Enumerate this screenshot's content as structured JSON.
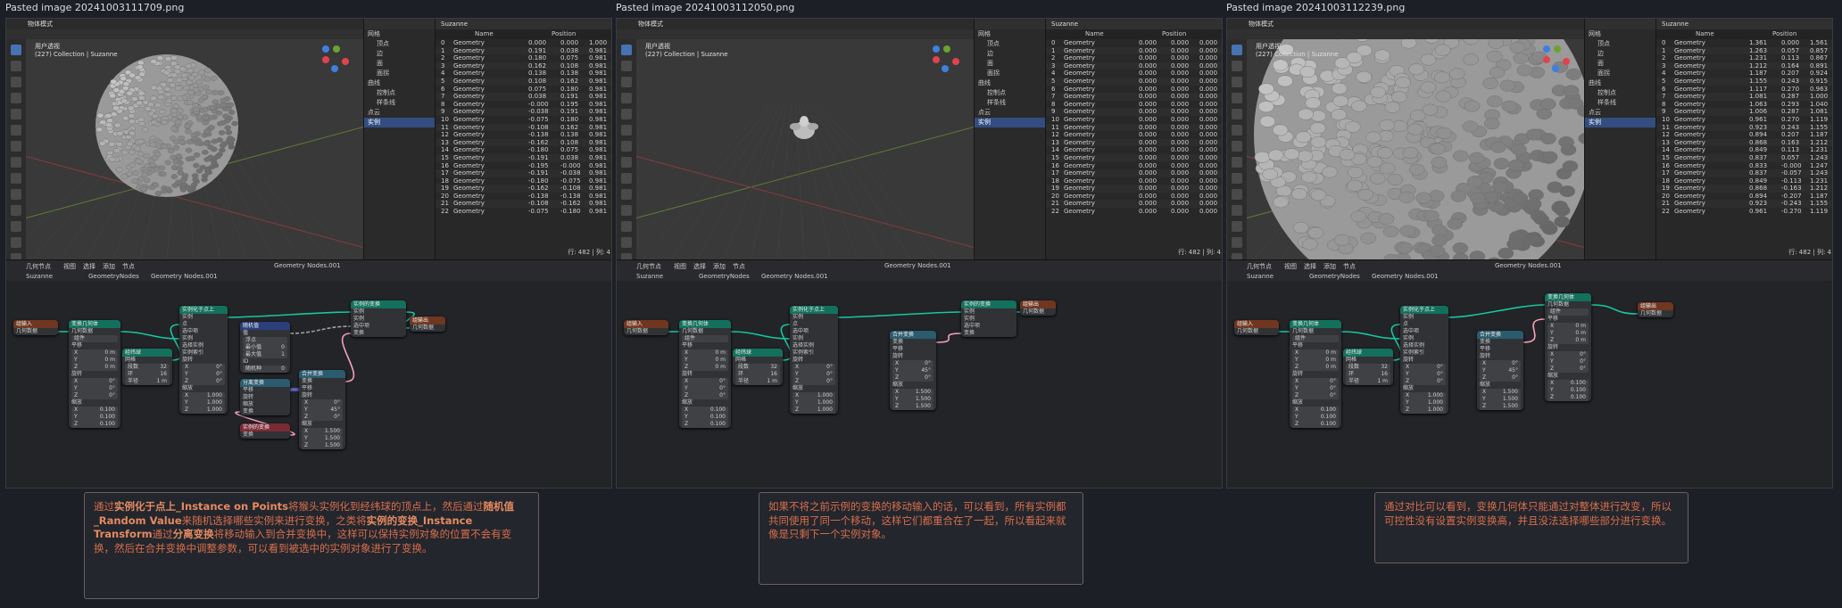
{
  "panels": [
    {
      "title": "Pasted image 20241003111709.png",
      "viewport": {
        "mode": "物体模式",
        "view_label": "用户透视",
        "collection": "(227) Collection | Suzanne",
        "object": "sphere-of-instances"
      },
      "outliner": {
        "name": "Suzanne",
        "items": [
          "网格",
          "顶点",
          "边",
          "面",
          "面拐",
          "曲线",
          "控制点",
          "样条线",
          "点云",
          "实例"
        ],
        "selected": "实例"
      },
      "spreadsheet": {
        "columns": [
          "Name",
          "Position"
        ],
        "rows": [
          [
            "0",
            "Geometry",
            "0.000",
            "0.000",
            "1.000"
          ],
          [
            "1",
            "Geometry",
            "0.191",
            "0.038",
            "0.981"
          ],
          [
            "2",
            "Geometry",
            "0.180",
            "0.075",
            "0.981"
          ],
          [
            "3",
            "Geometry",
            "0.162",
            "0.108",
            "0.981"
          ],
          [
            "4",
            "Geometry",
            "0.138",
            "0.138",
            "0.981"
          ],
          [
            "5",
            "Geometry",
            "0.108",
            "0.162",
            "0.981"
          ],
          [
            "6",
            "Geometry",
            "0.075",
            "0.180",
            "0.981"
          ],
          [
            "7",
            "Geometry",
            "0.038",
            "0.191",
            "0.981"
          ],
          [
            "8",
            "Geometry",
            "-0.000",
            "0.195",
            "0.981"
          ],
          [
            "9",
            "Geometry",
            "-0.038",
            "0.191",
            "0.981"
          ],
          [
            "10",
            "Geometry",
            "-0.075",
            "0.180",
            "0.981"
          ],
          [
            "11",
            "Geometry",
            "-0.108",
            "0.162",
            "0.981"
          ],
          [
            "12",
            "Geometry",
            "-0.138",
            "0.138",
            "0.981"
          ],
          [
            "13",
            "Geometry",
            "-0.162",
            "0.108",
            "0.981"
          ],
          [
            "14",
            "Geometry",
            "-0.180",
            "0.075",
            "0.981"
          ],
          [
            "15",
            "Geometry",
            "-0.191",
            "0.038",
            "0.981"
          ],
          [
            "16",
            "Geometry",
            "-0.195",
            "-0.000",
            "0.981"
          ],
          [
            "17",
            "Geometry",
            "-0.191",
            "-0.038",
            "0.981"
          ],
          [
            "18",
            "Geometry",
            "-0.180",
            "-0.075",
            "0.981"
          ],
          [
            "19",
            "Geometry",
            "-0.162",
            "-0.108",
            "0.981"
          ],
          [
            "20",
            "Geometry",
            "-0.138",
            "-0.138",
            "0.981"
          ],
          [
            "21",
            "Geometry",
            "-0.108",
            "-0.162",
            "0.981"
          ],
          [
            "22",
            "Geometry",
            "-0.075",
            "-0.180",
            "0.981"
          ]
        ],
        "footer": "行: 482 | 列: 4"
      },
      "editor": {
        "tree": "Geometry Nodes.001",
        "breadcrumb": [
          "Suzanne",
          "GeometryNodes",
          "Geometry Nodes.001"
        ]
      }
    },
    {
      "title": "Pasted image 20241003112050.png",
      "viewport": {
        "mode": "物体模式",
        "view_label": "用户透视",
        "collection": "(227) Collection | Suzanne",
        "object": "collapsed-instance"
      },
      "outliner": {
        "name": "Suzanne",
        "items": [
          "网格",
          "顶点",
          "边",
          "面",
          "面拐",
          "曲线",
          "控制点",
          "样条线",
          "点云",
          "实例"
        ],
        "selected": "实例"
      },
      "spreadsheet": {
        "columns": [
          "Name",
          "Position"
        ],
        "rows": [
          [
            "0",
            "Geometry",
            "0.000",
            "0.000",
            "0.000"
          ],
          [
            "1",
            "Geometry",
            "0.000",
            "0.000",
            "0.000"
          ],
          [
            "2",
            "Geometry",
            "0.000",
            "0.000",
            "0.000"
          ],
          [
            "3",
            "Geometry",
            "0.000",
            "0.000",
            "0.000"
          ],
          [
            "4",
            "Geometry",
            "0.000",
            "0.000",
            "0.000"
          ],
          [
            "5",
            "Geometry",
            "0.000",
            "0.000",
            "0.000"
          ],
          [
            "6",
            "Geometry",
            "0.000",
            "0.000",
            "0.000"
          ],
          [
            "7",
            "Geometry",
            "0.000",
            "0.000",
            "0.000"
          ],
          [
            "8",
            "Geometry",
            "0.000",
            "0.000",
            "0.000"
          ],
          [
            "9",
            "Geometry",
            "0.000",
            "0.000",
            "0.000"
          ],
          [
            "10",
            "Geometry",
            "0.000",
            "0.000",
            "0.000"
          ],
          [
            "11",
            "Geometry",
            "0.000",
            "0.000",
            "0.000"
          ],
          [
            "12",
            "Geometry",
            "0.000",
            "0.000",
            "0.000"
          ],
          [
            "13",
            "Geometry",
            "0.000",
            "0.000",
            "0.000"
          ],
          [
            "14",
            "Geometry",
            "0.000",
            "0.000",
            "0.000"
          ],
          [
            "15",
            "Geometry",
            "0.000",
            "0.000",
            "0.000"
          ],
          [
            "16",
            "Geometry",
            "0.000",
            "0.000",
            "0.000"
          ],
          [
            "17",
            "Geometry",
            "0.000",
            "0.000",
            "0.000"
          ],
          [
            "18",
            "Geometry",
            "0.000",
            "0.000",
            "0.000"
          ],
          [
            "19",
            "Geometry",
            "0.000",
            "0.000",
            "0.000"
          ],
          [
            "20",
            "Geometry",
            "0.000",
            "0.000",
            "0.000"
          ],
          [
            "21",
            "Geometry",
            "0.000",
            "0.000",
            "0.000"
          ],
          [
            "22",
            "Geometry",
            "0.000",
            "0.000",
            "0.000"
          ]
        ],
        "footer": "行: 482 | 列: 4"
      },
      "editor": {
        "tree": "Geometry Nodes.001",
        "breadcrumb": [
          "Suzanne",
          "GeometryNodes",
          "Geometry Nodes.001"
        ]
      }
    },
    {
      "title": "Pasted image 20241003112239.png",
      "viewport": {
        "mode": "物体模式",
        "view_label": "用户透视",
        "collection": "(227) Collection | Suzanne",
        "object": "large-sphere-closeup"
      },
      "outliner": {
        "name": "Suzanne",
        "items": [
          "网格",
          "顶点",
          "边",
          "面",
          "面拐",
          "曲线",
          "控制点",
          "样条线",
          "点云",
          "实例"
        ],
        "selected": "实例"
      },
      "spreadsheet": {
        "columns": [
          "Name",
          "Position"
        ],
        "rows": [
          [
            "0",
            "Geometry",
            "1.361",
            "0.000",
            "1.561"
          ],
          [
            "1",
            "Geometry",
            "1.263",
            "0.057",
            "0.857"
          ],
          [
            "2",
            "Geometry",
            "1.231",
            "0.113",
            "0.867"
          ],
          [
            "3",
            "Geometry",
            "1.212",
            "0.164",
            "0.891"
          ],
          [
            "4",
            "Geometry",
            "1.187",
            "0.207",
            "0.924"
          ],
          [
            "5",
            "Geometry",
            "1.155",
            "0.243",
            "0.915"
          ],
          [
            "6",
            "Geometry",
            "1.117",
            "0.270",
            "0.963"
          ],
          [
            "7",
            "Geometry",
            "1.081",
            "0.287",
            "1.000"
          ],
          [
            "8",
            "Geometry",
            "1.063",
            "0.293",
            "1.040"
          ],
          [
            "9",
            "Geometry",
            "1.006",
            "0.287",
            "1.081"
          ],
          [
            "10",
            "Geometry",
            "0.961",
            "0.270",
            "1.119"
          ],
          [
            "11",
            "Geometry",
            "0.923",
            "0.243",
            "1.155"
          ],
          [
            "12",
            "Geometry",
            "0.894",
            "0.207",
            "1.187"
          ],
          [
            "13",
            "Geometry",
            "0.868",
            "0.163",
            "1.212"
          ],
          [
            "14",
            "Geometry",
            "0.849",
            "0.113",
            "1.231"
          ],
          [
            "15",
            "Geometry",
            "0.837",
            "0.057",
            "1.243"
          ],
          [
            "16",
            "Geometry",
            "0.833",
            "-0.000",
            "1.247"
          ],
          [
            "17",
            "Geometry",
            "0.837",
            "-0.057",
            "1.243"
          ],
          [
            "18",
            "Geometry",
            "0.849",
            "-0.113",
            "1.231"
          ],
          [
            "19",
            "Geometry",
            "0.868",
            "-0.163",
            "1.212"
          ],
          [
            "20",
            "Geometry",
            "0.894",
            "-0.207",
            "1.187"
          ],
          [
            "21",
            "Geometry",
            "0.923",
            "-0.243",
            "1.155"
          ],
          [
            "22",
            "Geometry",
            "0.961",
            "-0.270",
            "1.119"
          ]
        ],
        "footer": "行: 482 | 列: 4"
      },
      "editor": {
        "tree": "Geometry Nodes.001",
        "breadcrumb": [
          "Suzanne",
          "GeometryNodes",
          "Geometry Nodes.001"
        ]
      }
    }
  ],
  "ui_labels": {
    "editor_type": "几何节点",
    "menus": [
      "视图",
      "选择",
      "添加",
      "节点"
    ],
    "group_input": "组输入",
    "group_output": "组输出",
    "geometry": "几何数据",
    "transform_geometry": "变换几何体",
    "instance_on_points": "实例化于点上",
    "ico_sphere": "经纬球",
    "random_value": "随机值",
    "separate_transform": "分离变换",
    "combine_transform": "合并变换",
    "instance_transform": "实例的变换",
    "translation": "平移",
    "rotation": "旋转",
    "scale": "缩放",
    "mesh": "网格",
    "points": "点",
    "selection": "选中项",
    "instance": "实例",
    "pick_instance": "选择实例",
    "instance_index": "实例索引",
    "instances": "实例",
    "transform": "变换",
    "segments": "段数",
    "rings": "环",
    "radius": "半径",
    "min": "最小值",
    "max": "最大值",
    "seed": "随机种",
    "float": "浮点",
    "value": "值",
    "id": "ID",
    "components": "组件"
  },
  "node_values": {
    "x": "X",
    "y": "Y",
    "z": "Z",
    "zero_m": "0 m",
    "one_m": "1 m",
    "zero_deg": "0°",
    "fortyfive_deg": "45°",
    "one": "1.000",
    "tenth": "0.100",
    "one_point_five": "1.500",
    "seg_32": "32",
    "rings_16": "16",
    "seed_0": "0",
    "int_1": "1"
  },
  "notes": [
    {
      "segments": [
        [
          "通过",
          false
        ],
        [
          "实例化于点上_Instance on Points",
          true
        ],
        [
          "将猴头实例化到经纬球的顶点上，然后通过",
          false
        ],
        [
          "随机值_Random Value",
          true
        ],
        [
          "来随机选择哪些实例来进行变换，之类将",
          false
        ],
        [
          "实例的变换_Instance Transform",
          true
        ],
        [
          "通过",
          false
        ],
        [
          "分离变换",
          true
        ],
        [
          "将移动输入到合并变换中，这样可以保持实例对象的位置不会有变换，然后在合并变换中调整参数，可以看到被选中的实例对象进行了变换。",
          false
        ]
      ]
    },
    {
      "segments": [
        [
          "如果不将之前示例的变换的移动输入的话，可以看到，所有实例都共同使用了同一个移动，这样它们都重合在了一起，所以看起来就像是只剩下一个实例对象。",
          false
        ]
      ]
    },
    {
      "segments": [
        [
          "通过对比可以看到，变换几何体只能通过对整体进行改变，所以可控性没有设置实例变换高，并且没法选择哪些部分进行变换。",
          false
        ]
      ]
    }
  ],
  "colors": {
    "geometry_link": "#17c6a0",
    "float_link": "#a1a1a1",
    "vector_link": "#6363c7",
    "rotation_link": "#a663c7",
    "matrix_link": "#f5a0b8",
    "note_text": "#d86e4c"
  }
}
